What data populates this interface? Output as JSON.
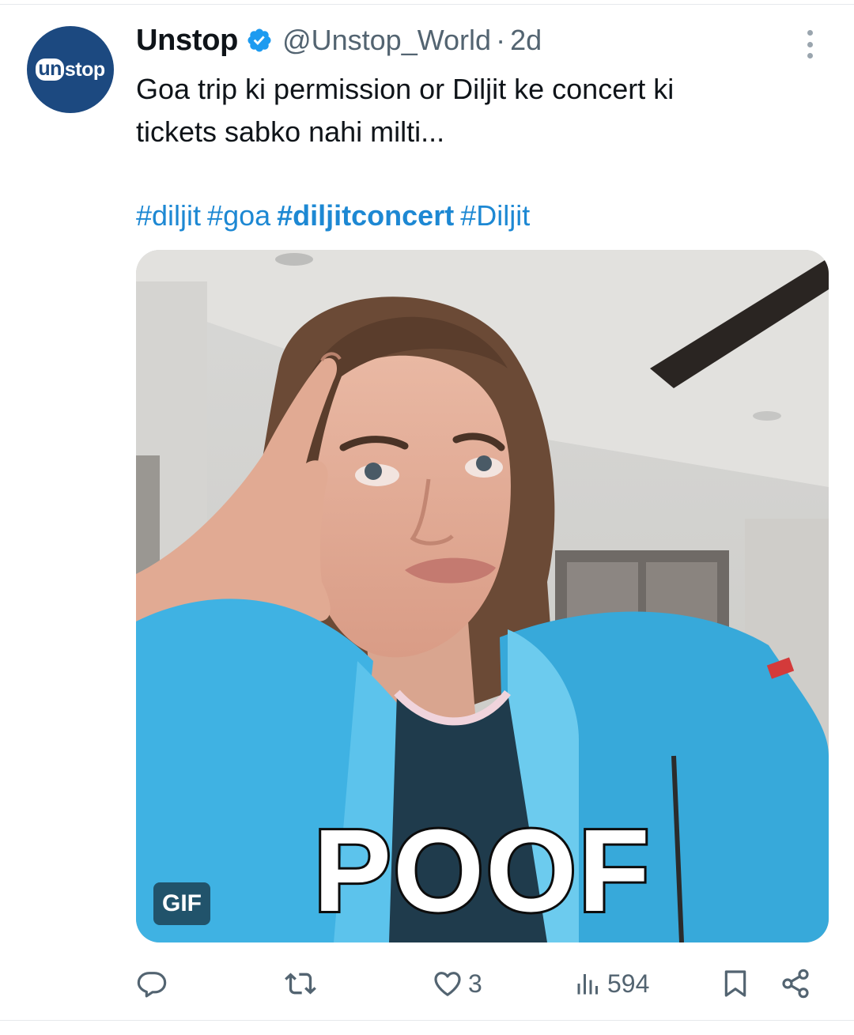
{
  "tweet": {
    "avatar_logo": {
      "prefix": "un",
      "suffix": "stop"
    },
    "display_name": "Unstop",
    "handle": "@Unstop_World",
    "separator": "·",
    "time": "2d",
    "text_lines": [
      "Goa trip ki permission or Diljit ke concert ki",
      "tickets sabko nahi milti..."
    ],
    "hashtags": [
      {
        "label": "#diljit",
        "bold": false
      },
      {
        "label": "#goa",
        "bold": false
      },
      {
        "label": "#diljitconcert",
        "bold": true
      },
      {
        "label": "#Diljit",
        "bold": false
      }
    ],
    "media": {
      "type": "gif",
      "caption": "POOF",
      "badge": "GIF"
    },
    "actions": {
      "reply": {
        "icon": "reply-icon",
        "count": ""
      },
      "retweet": {
        "icon": "retweet-icon",
        "count": ""
      },
      "like": {
        "icon": "heart-icon",
        "count": "3"
      },
      "views": {
        "icon": "views-icon",
        "count": "594"
      },
      "bookmark": {
        "icon": "bookmark-icon"
      },
      "share": {
        "icon": "share-icon"
      }
    }
  },
  "colors": {
    "link": "#1d88d3",
    "verified": "#1d9bf0",
    "muted": "#536471",
    "avatar_bg": "#1c4980"
  }
}
